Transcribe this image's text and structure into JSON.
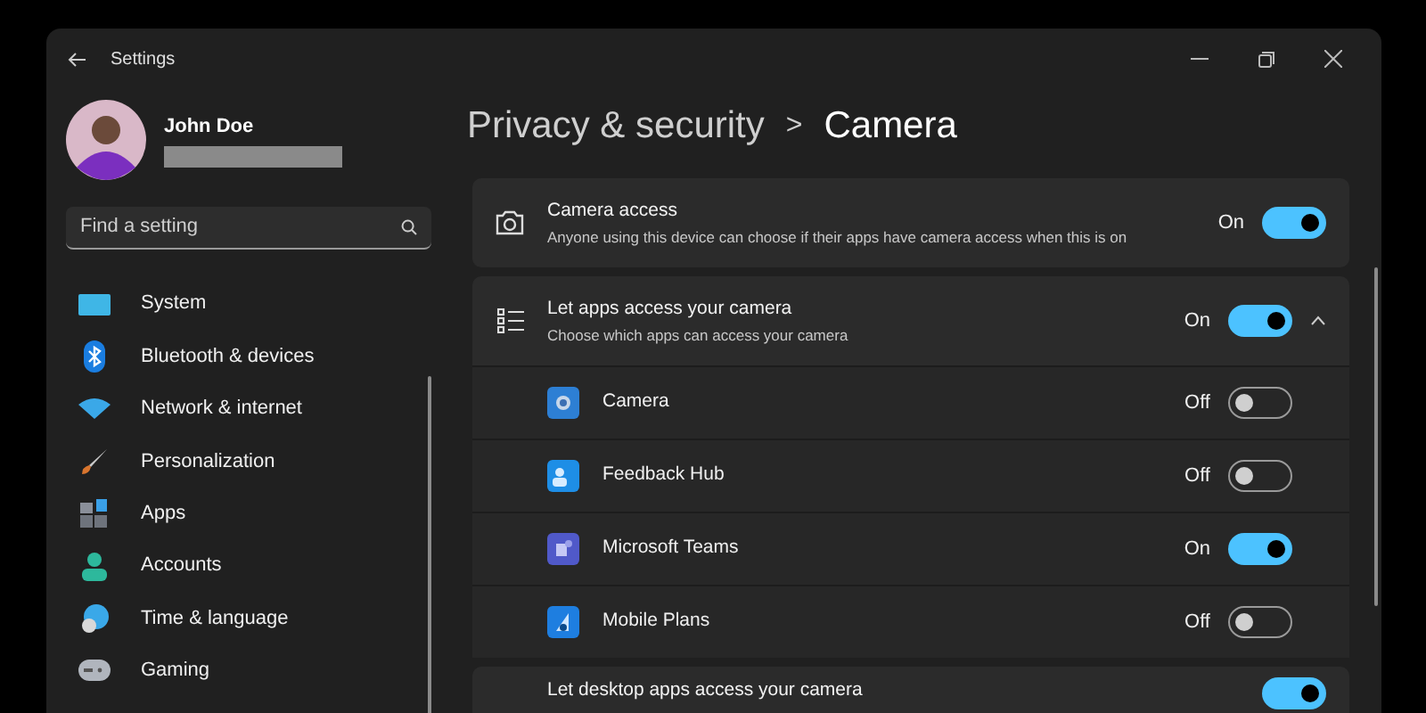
{
  "window": {
    "title": "Settings"
  },
  "profile": {
    "name": "John Doe"
  },
  "search": {
    "placeholder": "Find a setting"
  },
  "sidebar": {
    "items": [
      {
        "label": "System",
        "selected": false
      },
      {
        "label": "Bluetooth & devices",
        "selected": false
      },
      {
        "label": "Network & internet",
        "selected": false
      },
      {
        "label": "Personalization",
        "selected": false
      },
      {
        "label": "Apps",
        "selected": false
      },
      {
        "label": "Accounts",
        "selected": false
      },
      {
        "label": "Time & language",
        "selected": false
      },
      {
        "label": "Gaming",
        "selected": false
      }
    ]
  },
  "breadcrumb": {
    "parent": "Privacy & security",
    "separator": ">",
    "current": "Camera"
  },
  "settings": [
    {
      "kind": "camera",
      "title": "Camera access",
      "description": "Anyone using this device can choose if their apps have camera access when this is on",
      "state_label": "On",
      "on": true
    },
    {
      "kind": "list",
      "title": "Let apps access your camera",
      "description": "Choose which apps can access your camera",
      "state_label": "On",
      "on": true,
      "expanded": true,
      "apps": [
        {
          "kind": "camera",
          "name": "Camera",
          "state_label": "Off",
          "on": false
        },
        {
          "kind": "feedback",
          "name": "Feedback Hub",
          "state_label": "Off",
          "on": false
        },
        {
          "kind": "teams",
          "name": "Microsoft Teams",
          "state_label": "On",
          "on": true
        },
        {
          "kind": "mobile",
          "name": "Mobile Plans",
          "state_label": "Off",
          "on": false
        }
      ]
    },
    {
      "kind": "desktop",
      "title": "Let desktop apps access your camera",
      "on": true
    }
  ]
}
